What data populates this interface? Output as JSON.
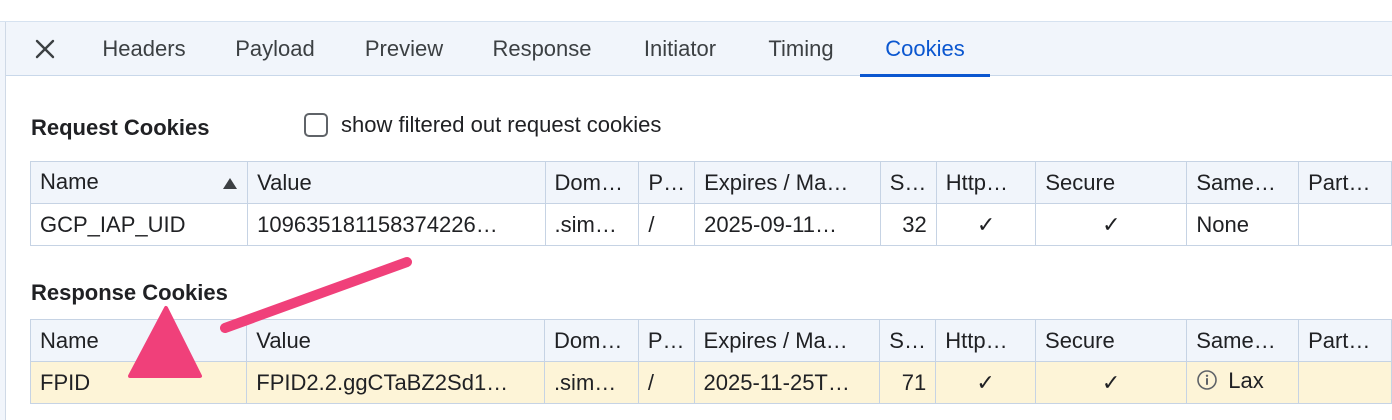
{
  "tabs": [
    {
      "label": "Headers",
      "active": false
    },
    {
      "label": "Payload",
      "active": false
    },
    {
      "label": "Preview",
      "active": false
    },
    {
      "label": "Response",
      "active": false
    },
    {
      "label": "Initiator",
      "active": false
    },
    {
      "label": "Timing",
      "active": false
    },
    {
      "label": "Cookies",
      "active": true
    }
  ],
  "request_cookies": {
    "title": "Request Cookies",
    "show_filtered_label": "show filtered out request cookies",
    "show_filtered_checked": false,
    "columns": [
      "Name",
      "Value",
      "Dom…",
      "P…",
      "Expires / Ma…",
      "S…",
      "Http…",
      "Secure",
      "Same…",
      "Part…"
    ],
    "sort_column": "Name",
    "sort_direction": "ascending",
    "rows": [
      {
        "name": "GCP_IAP_UID",
        "value": "109635181158374226…",
        "domain": ".sim…",
        "path": "/",
        "expires": "2025-09-11…",
        "size": "32",
        "http_only": "✓",
        "secure": "✓",
        "same_site": "None",
        "partition": ""
      }
    ]
  },
  "response_cookies": {
    "title": "Response Cookies",
    "columns": [
      "Name",
      "Value",
      "Dom…",
      "P…",
      "Expires / Ma…",
      "S…",
      "Http…",
      "Secure",
      "Same…",
      "Part…"
    ],
    "rows": [
      {
        "name": "FPID",
        "value": "FPID2.2.ggCTaBZ2Sd1…",
        "domain": ".sim…",
        "path": "/",
        "expires": "2025-11-25T…",
        "size": "71",
        "http_only": "✓",
        "secure": "✓",
        "same_site": "Lax",
        "partition": "",
        "same_site_icon": "info-icon",
        "highlighted": true
      }
    ]
  },
  "colors": {
    "accent": "#0b57d0",
    "annotation_arrow": "#f0407a",
    "highlight_row": "#fdf4d7",
    "header_bg": "#f1f5fb"
  }
}
